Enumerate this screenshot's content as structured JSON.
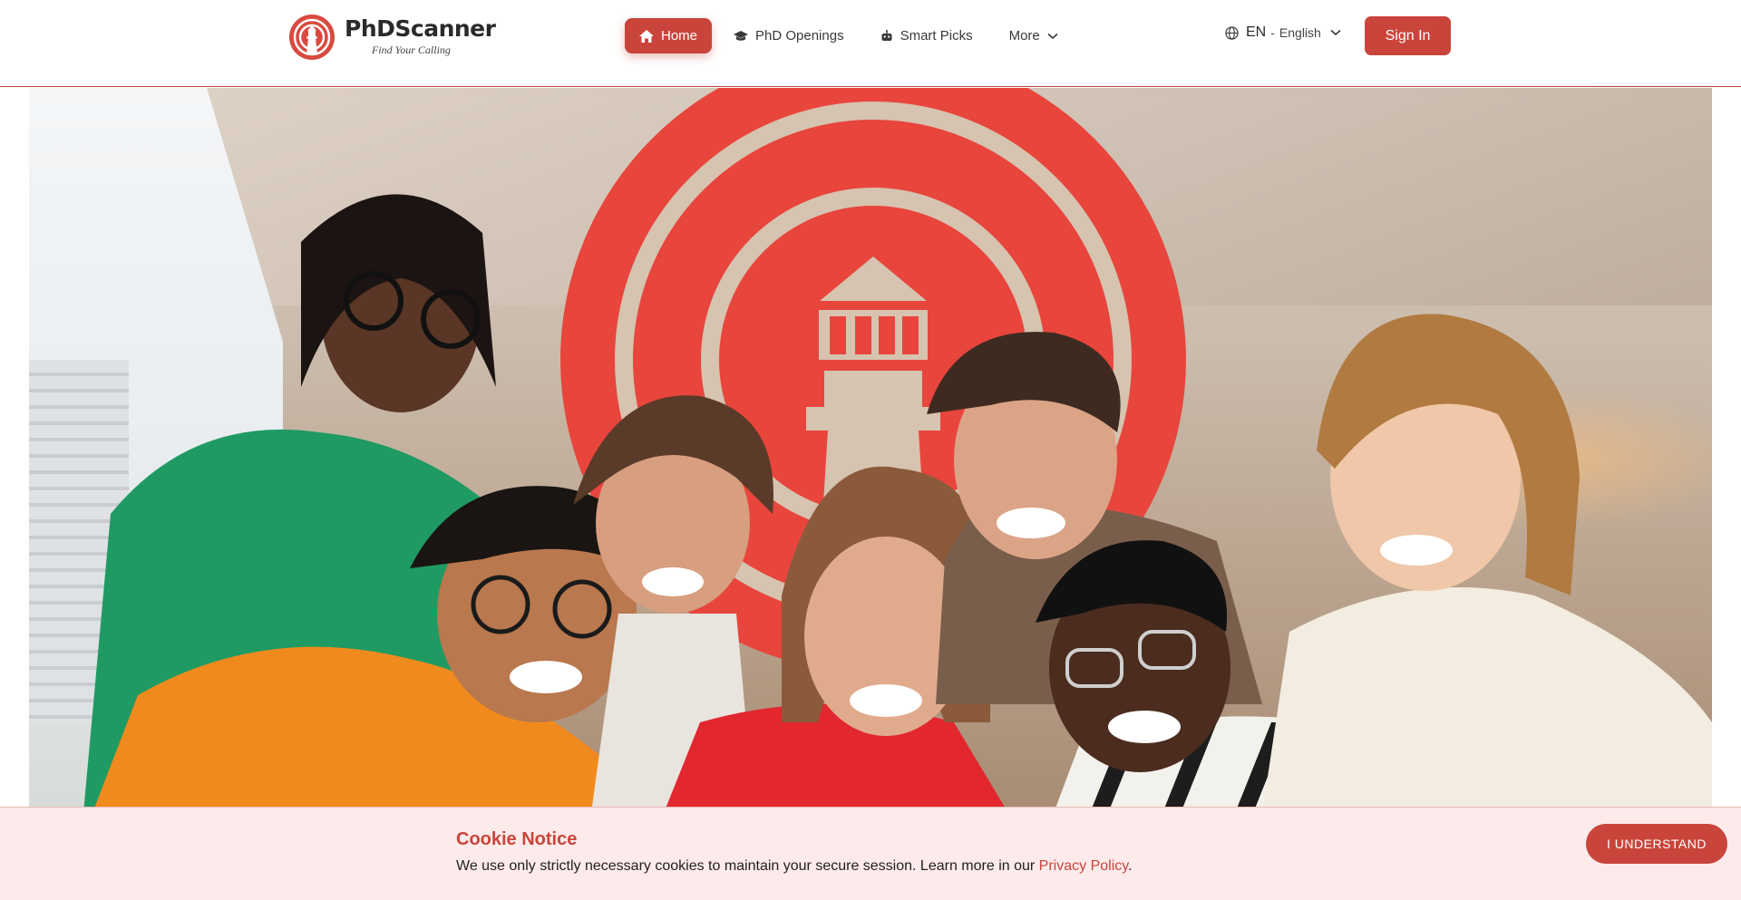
{
  "brand": {
    "name": "PhDScanner",
    "tagline": "Find Your Calling",
    "color": "#c9453b"
  },
  "nav": {
    "items": [
      {
        "label": "Home",
        "icon": "home-icon",
        "active": true
      },
      {
        "label": "PhD Openings",
        "icon": "graduation-cap-icon",
        "active": false
      },
      {
        "label": "Smart Picks",
        "icon": "robot-icon",
        "active": false
      },
      {
        "label": "More",
        "icon": "chevron-down-icon",
        "active": false
      }
    ]
  },
  "language": {
    "code": "EN",
    "separator": "-",
    "name": "English",
    "icon": "globe-icon"
  },
  "auth": {
    "signin_label": "Sign In"
  },
  "hero": {
    "image_description_icon": "lighthouse-logo"
  },
  "cookie": {
    "title": "Cookie Notice",
    "text": "We use only strictly necessary cookies to maintain your secure session. Learn more in our",
    "link": "Privacy Policy",
    "end": ".",
    "button": "I UNDERSTAND"
  }
}
